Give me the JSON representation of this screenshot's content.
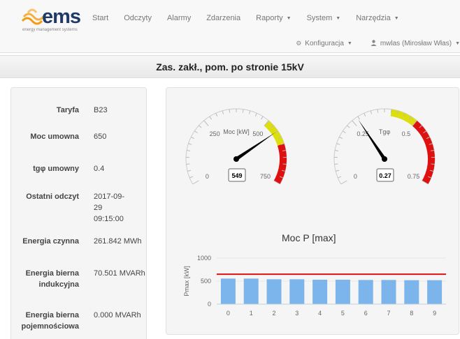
{
  "logo": {
    "text": "ems",
    "subtitle": "energy management systems",
    "icon": "sun-waves-icon"
  },
  "nav": {
    "items": [
      {
        "label": "Start",
        "dropdown": false
      },
      {
        "label": "Odczyty",
        "dropdown": false
      },
      {
        "label": "Alarmy",
        "dropdown": false
      },
      {
        "label": "Zdarzenia",
        "dropdown": false
      },
      {
        "label": "Raporty",
        "dropdown": true
      },
      {
        "label": "System",
        "dropdown": true
      },
      {
        "label": "Narzędzia",
        "dropdown": true
      }
    ],
    "config_label": "Konfiguracja",
    "config_icon": "gears-icon",
    "user_label": "mwlas (Mirosław Włas)",
    "user_icon": "user-icon"
  },
  "page_title": "Zas. zakł., pom. po stronie 15kV",
  "info": [
    {
      "label": "Taryfa",
      "value": "B23"
    },
    {
      "label": "Moc umowna",
      "value": "650"
    },
    {
      "label": "tgφ umowny",
      "value": "0.4"
    },
    {
      "label": "Ostatni odczyt",
      "value": "2017-09-29 09:15:00"
    },
    {
      "label": "Energia czynna",
      "value": "261.842 MWh"
    },
    {
      "label": "Energia bierna indukcyjna",
      "value": "70.501 MVARh"
    },
    {
      "label": "Energia bierna pojemnościowa",
      "value": "0.000 MVARh"
    }
  ],
  "gauges": [
    {
      "name": "Moc [kW]",
      "min": 0,
      "max": 750,
      "value": 549,
      "display": "549",
      "ticks": [
        "0",
        "250",
        "500",
        "750"
      ],
      "bands": [
        {
          "from": 500,
          "to": 600,
          "color": "#dddf0d"
        },
        {
          "from": 600,
          "to": 750,
          "color": "#df1010"
        }
      ]
    },
    {
      "name": "Tgφ",
      "min": 0,
      "max": 0.75,
      "value": 0.27,
      "display": "0.27",
      "ticks": [
        "0",
        "0.25",
        "0.5",
        "0.75"
      ],
      "bands": [
        {
          "from": 0.4,
          "to": 0.5,
          "color": "#dddf0d"
        },
        {
          "from": 0.5,
          "to": 0.75,
          "color": "#df1010"
        }
      ]
    }
  ],
  "colors": {
    "bar": "#7cb5ec",
    "limit": "#df1010",
    "band_yellow": "#dddf0d",
    "band_red": "#df1010"
  },
  "chart_data": {
    "type": "bar",
    "title": "Moc P [max]",
    "xlabel": "",
    "ylabel": "Pmax [kW]",
    "categories": [
      "0",
      "1",
      "2",
      "3",
      "4",
      "5",
      "6",
      "7",
      "8",
      "9"
    ],
    "series": [
      {
        "values": [
          555,
          555,
          540,
          540,
          530,
          530,
          525,
          525,
          520,
          520
        ]
      }
    ],
    "limit_line": 650,
    "yticks": [
      "0",
      "500",
      "1000"
    ],
    "ylim": [
      0,
      1000
    ],
    "grid": true,
    "legend": "none"
  }
}
